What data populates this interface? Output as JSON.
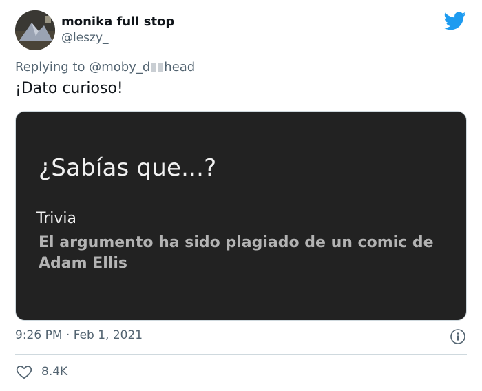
{
  "author": {
    "display_name": "monika full stop",
    "handle": "@leszy_",
    "avatar_icon": "user-avatar"
  },
  "platform_icon": "twitter-bird-icon",
  "reply": {
    "prefix": "Replying to",
    "handle_start": "@moby_d",
    "handle_end": "head"
  },
  "tweet": {
    "text": "¡Dato curioso!"
  },
  "media": {
    "question": "¿Sabías que...?",
    "trivia_label": "Trivia",
    "trivia_text": "El argumento ha sido plagiado de un comic de Adam Ellis"
  },
  "meta": {
    "time": "9:26 PM",
    "separator": "·",
    "date": "Feb 1, 2021",
    "info_icon": "info-icon"
  },
  "actions": {
    "like_icon": "heart-icon",
    "like_count": "8.4K"
  },
  "colors": {
    "brand": "#1d9bf0",
    "secondary_text": "#536471",
    "media_background": "#222222"
  }
}
